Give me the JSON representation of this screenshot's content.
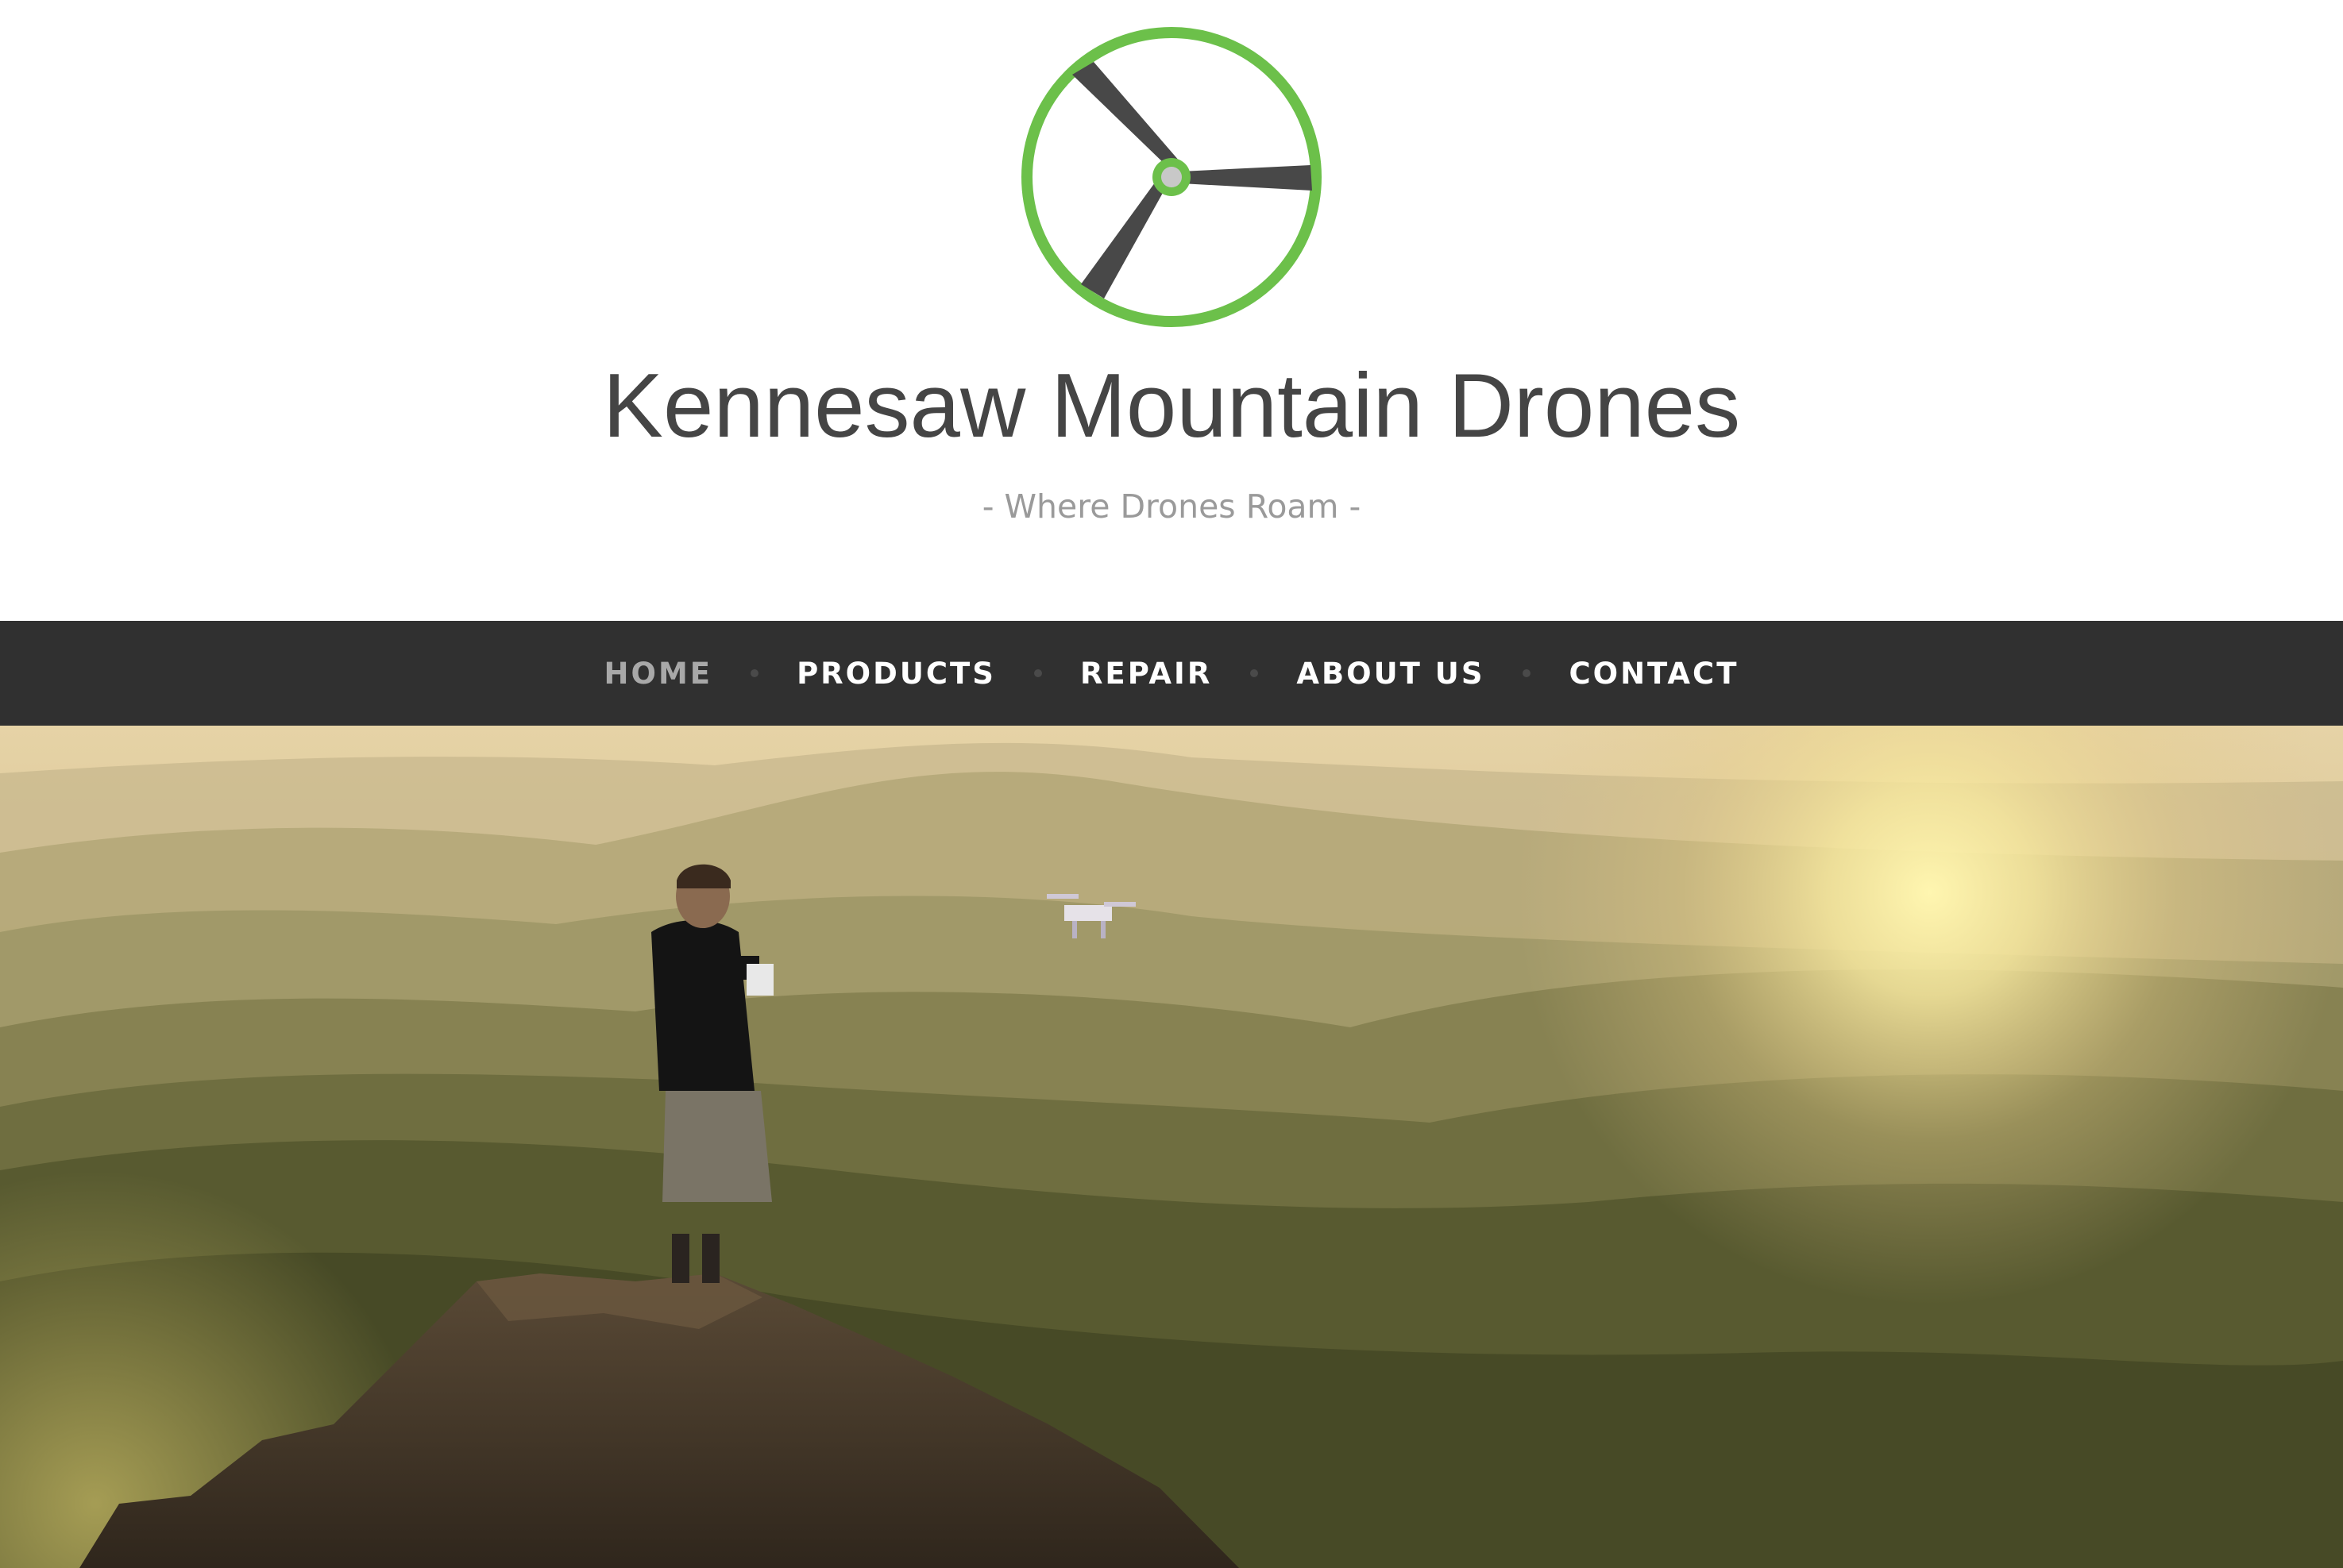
{
  "site": {
    "title": "Kennesaw Mountain Drones",
    "tagline": "- Where Drones Roam -",
    "logo_icon": "drone-propeller-icon"
  },
  "colors": {
    "accent_green": "#6cc04a",
    "nav_background": "#303030",
    "nav_text": "#ffffff",
    "nav_active_text": "#a8a8a8",
    "title_text": "#454545",
    "tagline_text": "#9a9a9a"
  },
  "nav": {
    "items": [
      {
        "label": "HOME",
        "active": true
      },
      {
        "label": "PRODUCTS",
        "active": false
      },
      {
        "label": "REPAIR",
        "active": false
      },
      {
        "label": "ABOUT US",
        "active": false
      },
      {
        "label": "CONTACT",
        "active": false
      }
    ]
  },
  "hero": {
    "image": "hiker-flying-drone-over-mountains-at-sunset"
  }
}
